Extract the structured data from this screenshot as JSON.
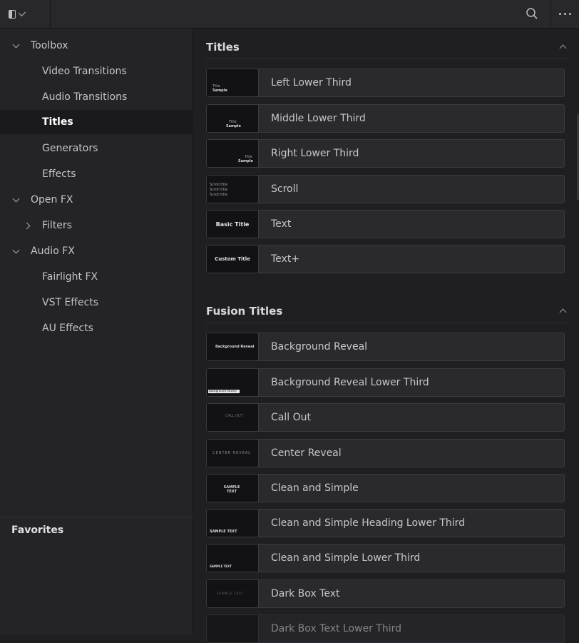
{
  "topbar": {
    "icons": [
      "panel-toggle-icon",
      "chevron-down-icon",
      "search-icon",
      "more-icon"
    ]
  },
  "sidebar": {
    "tree": [
      {
        "label": "Toolbox",
        "level": 0,
        "expander": "down"
      },
      {
        "label": "Video Transitions",
        "level": 1
      },
      {
        "label": "Audio Transitions",
        "level": 1
      },
      {
        "label": "Titles",
        "level": 1,
        "selected": true
      },
      {
        "label": "Generators",
        "level": 1
      },
      {
        "label": "Effects",
        "level": 1
      },
      {
        "label": "Open FX",
        "level": 0,
        "expander": "down"
      },
      {
        "label": "Filters",
        "level": 1,
        "expander": "right"
      },
      {
        "label": "Audio FX",
        "level": 0,
        "expander": "down"
      },
      {
        "label": "Fairlight FX",
        "level": 1
      },
      {
        "label": "VST Effects",
        "level": 1
      },
      {
        "label": "AU Effects",
        "level": 1
      }
    ],
    "favorites_label": "Favorites"
  },
  "sections": {
    "titles": {
      "header": "Titles",
      "items": [
        {
          "name": "Left Lower Third",
          "thumb_title": "Title",
          "thumb_sample": "Sample"
        },
        {
          "name": "Middle Lower Third",
          "thumb_title": "Title",
          "thumb_sample": "Sample"
        },
        {
          "name": "Right Lower Third",
          "thumb_title": "Title",
          "thumb_sample": "Sample"
        },
        {
          "name": "Scroll",
          "thumb_lines": [
            "Scroll title",
            "Scroll title",
            "Scroll title"
          ]
        },
        {
          "name": "Text",
          "thumb_label": "Basic Title"
        },
        {
          "name": "Text+",
          "thumb_label": "Custom Title"
        }
      ]
    },
    "fusion_titles": {
      "header": "Fusion Titles",
      "items": [
        {
          "name": "Background Reveal",
          "thumb_label": "Background Reveal"
        },
        {
          "name": "Background Reveal Lower Third",
          "thumb_label": "Background Reveal"
        },
        {
          "name": "Call Out",
          "thumb_label": "CALL OUT"
        },
        {
          "name": "Center Reveal",
          "thumb_label": "CENTER REVEAL"
        },
        {
          "name": "Clean and Simple",
          "thumb_label": "SAMPLE TEXT"
        },
        {
          "name": "Clean and Simple Heading Lower Third",
          "thumb_label": "SAMPLE TEXT"
        },
        {
          "name": "Clean and Simple Lower Third",
          "thumb_label": "SAMPLE TEXT"
        },
        {
          "name": "Dark Box Text",
          "thumb_label": "SAMPLE TEXT"
        },
        {
          "name": "Dark Box Text Lower Third",
          "thumb_label": ""
        }
      ]
    }
  }
}
